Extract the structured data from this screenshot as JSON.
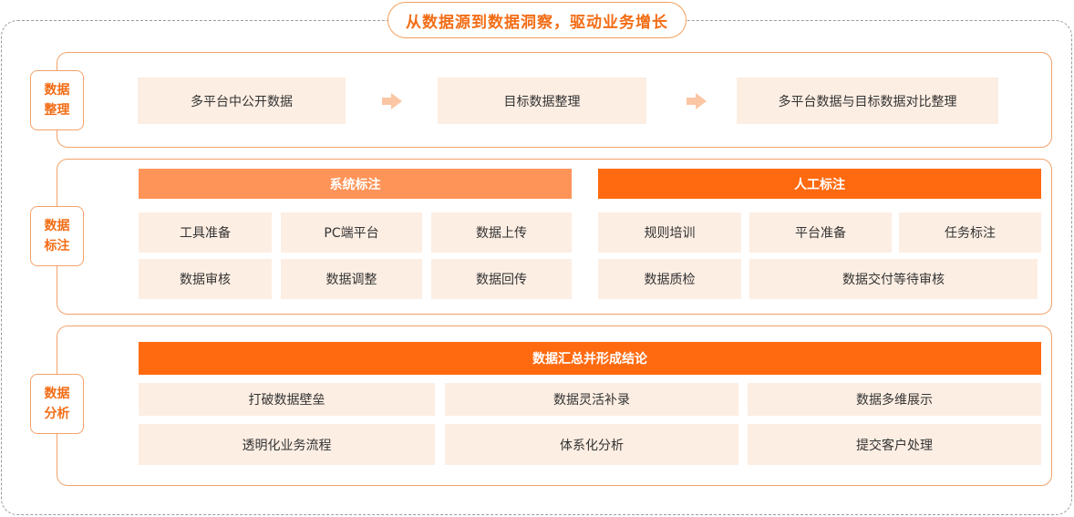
{
  "title": "从数据源到数据洞察，驱动业务增长",
  "colors": {
    "accent": "#ff6a10",
    "accent_light": "#ff9458",
    "cell_bg": "#fdeee3",
    "border": "#f2a36a"
  },
  "sections": {
    "organize": {
      "tag_line1": "数据",
      "tag_line2": "整理",
      "steps": [
        "多平台中公开数据",
        "目标数据整理",
        "多平台数据与目标数据对比整理"
      ],
      "arrow_icon": "arrow-right-icon"
    },
    "annotate": {
      "tag_line1": "数据",
      "tag_line2": "标注",
      "system": {
        "header": "系统标注",
        "items": [
          "工具准备",
          "PC端平台",
          "数据上传",
          "数据审核",
          "数据调整",
          "数据回传"
        ]
      },
      "manual": {
        "header": "人工标注",
        "items": [
          "规则培训",
          "平台准备",
          "任务标注",
          "数据质检",
          "数据交付等待审核"
        ]
      }
    },
    "analyze": {
      "tag_line1": "数据",
      "tag_line2": "分析",
      "header": "数据汇总并形成结论",
      "items": [
        "打破数据壁垒",
        "数据灵活补录",
        "数据多维展示",
        "透明化业务流程",
        "体系化分析",
        "提交客户处理"
      ]
    }
  }
}
